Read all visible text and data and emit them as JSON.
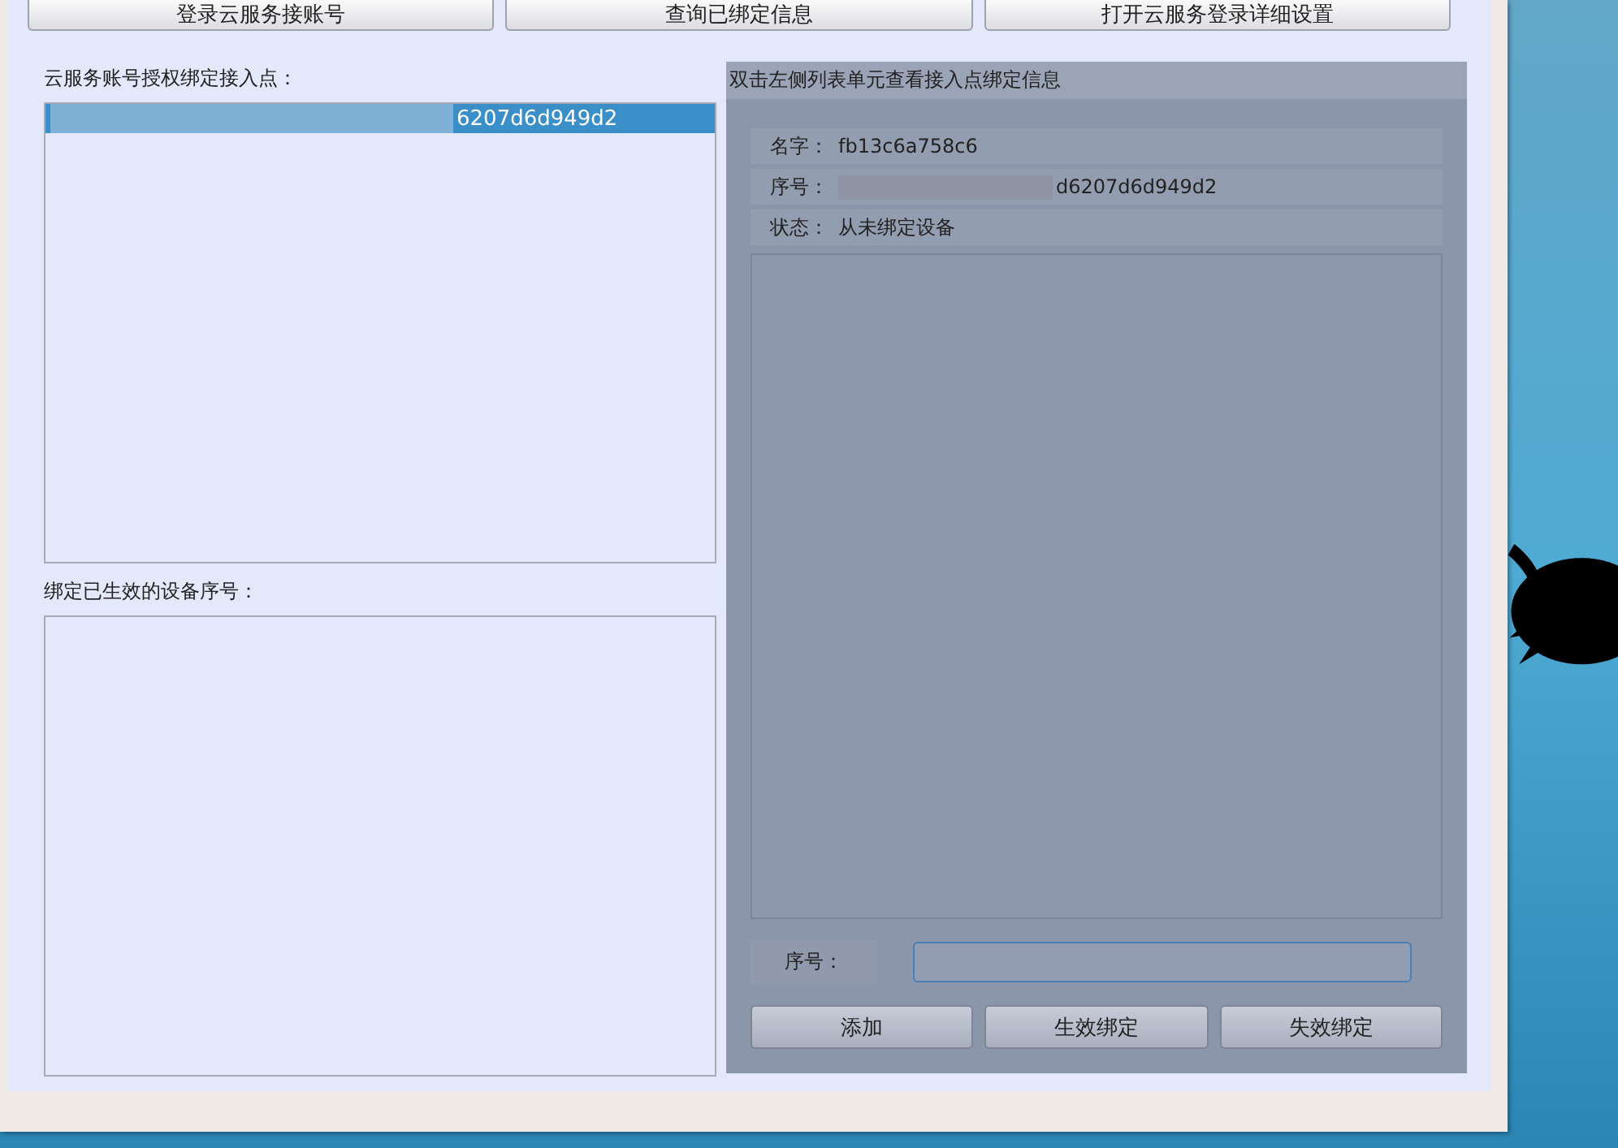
{
  "toolbar": {
    "buttons": [
      "登录云服务接账号",
      "查询已绑定信息",
      "打开云服务登录详细设置"
    ]
  },
  "access_points": {
    "label": "云服务账号授权绑定接入点：",
    "items": [
      {
        "text": "6207d6d949d2",
        "selected": true,
        "redacted": true
      }
    ]
  },
  "bound_devices": {
    "label": "绑定已生效的设备序号："
  },
  "detail": {
    "title": "双击左侧列表单元查看接入点绑定信息",
    "fields": [
      {
        "label": "名字：",
        "value": "fb13c6a758c6",
        "redacted": false
      },
      {
        "label": "序号：",
        "value": "d6207d6d949d2",
        "redacted": true
      },
      {
        "label": "状态：",
        "value": "从未绑定设备",
        "redacted": false
      }
    ],
    "serial_input": {
      "label": "序号："
    },
    "buttons": [
      "添加",
      "生效绑定",
      "失效绑定"
    ]
  }
}
